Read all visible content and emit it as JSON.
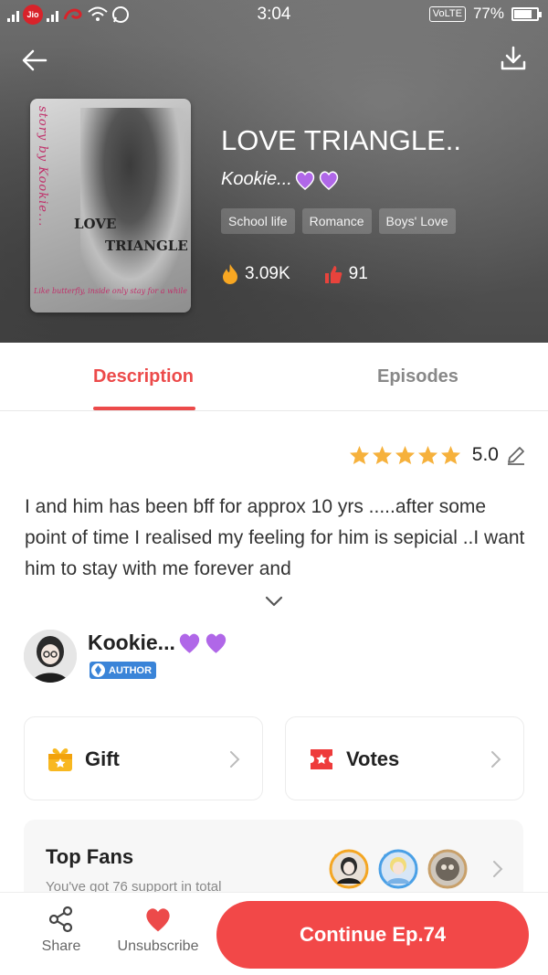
{
  "status_bar": {
    "time": "3:04",
    "volte": "VoLTE",
    "battery": "77%",
    "carrier_icon": "Jio"
  },
  "book": {
    "title": "LOVE TRIANGLE..",
    "author": "Kookie...",
    "tags": [
      "School life",
      "Romance",
      "Boys' Love"
    ],
    "views": "3.09K",
    "votes": "91"
  },
  "cover": {
    "side_text": "story by Kookie...",
    "title_line1": "LOVE",
    "title_line2": "TRIANGLE",
    "tagline": "Like butterfly, inside only stay for a while"
  },
  "tabs": [
    "Description",
    "Episodes"
  ],
  "active_tab": "Description",
  "rating": {
    "value": "5.0",
    "stars": 5
  },
  "description": "I and him has been bff for approx 10 yrs .....after some point of time I realised my feeling for him is sepicial ..I want him to stay with me forever and",
  "author_section": {
    "name": "Kookie...",
    "badge": "AUTHOR"
  },
  "cards": {
    "gift": "Gift",
    "votes": "Votes"
  },
  "top_fans": {
    "title": "Top Fans",
    "subtitle": "You've got 76 support in total"
  },
  "bottom": {
    "share": "Share",
    "unsubscribe": "Unsubscribe",
    "continue": "Continue Ep.74"
  },
  "colors": {
    "accent": "#ec4a4a",
    "star": "#f6b13c",
    "heart": "#9b4fd8",
    "author_badge": "#3a84d8"
  },
  "icons": [
    "back-arrow-icon",
    "download-icon",
    "fire-icon",
    "thumb-vote-icon",
    "edit-icon",
    "chevron-down-icon",
    "gift-icon",
    "ticket-icon",
    "share-icon",
    "heart-icon",
    "purple-heart-icon"
  ]
}
